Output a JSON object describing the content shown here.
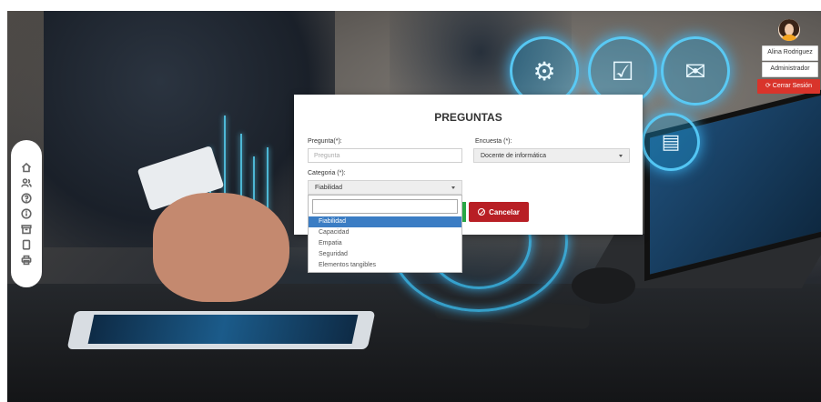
{
  "modal": {
    "title": "PREGUNTAS",
    "pregunta_label": "Pregunta(*):",
    "pregunta_placeholder": "Pregunta",
    "encuesta_label": "Encuesta (*):",
    "encuesta_value": "Docente de informática",
    "categoria_label": "Categoria (*):",
    "categoria_value": "Fiabilidad",
    "cancel_label": "Cancelar"
  },
  "dropdown": {
    "options": [
      "Fiabilidad",
      "Capacidad",
      "Empatia",
      "Seguridad",
      "Elementos tangibles"
    ],
    "selected_index": 0
  },
  "user": {
    "name": "Alina Rodriguez",
    "role": "Administrador",
    "logout_label": "⟳ Cerrar Sesión"
  },
  "sidebar": {
    "icons": [
      "home-icon",
      "users-icon",
      "help-circle-icon",
      "info-icon",
      "archive-icon",
      "clipboard-icon",
      "printer-icon"
    ]
  },
  "colors": {
    "cancel": "#b81f25",
    "save": "#28a745",
    "logout": "#d9342b",
    "selected_option": "#3b7dc4"
  }
}
